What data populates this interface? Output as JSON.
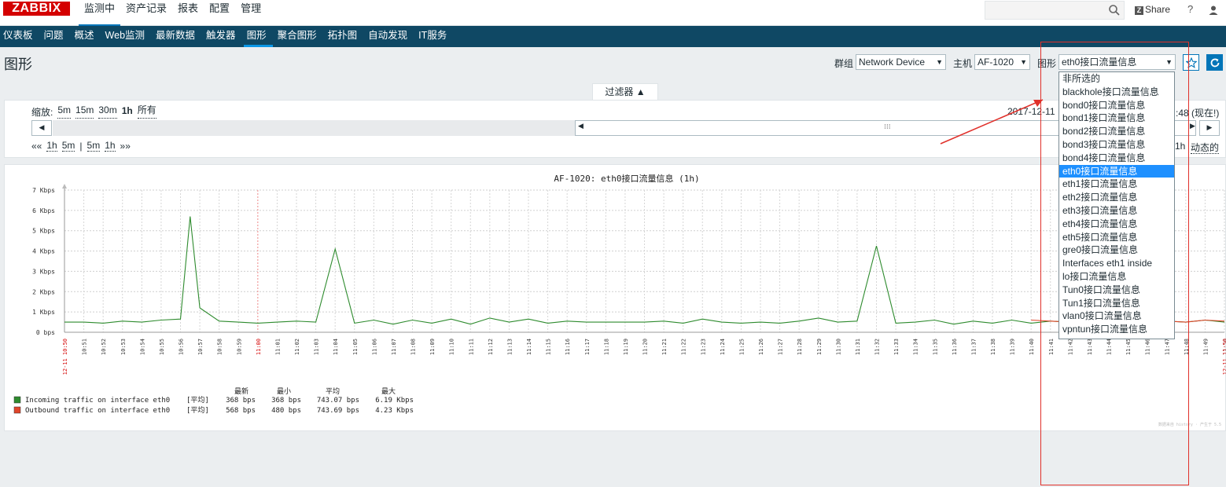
{
  "app": {
    "logo": "ZABBIX",
    "main_menu": [
      "监测中",
      "资产记录",
      "报表",
      "配置",
      "管理"
    ],
    "share": "Share",
    "help": "?",
    "share_badge": "Z"
  },
  "submenu": [
    "仪表板",
    "问题",
    "概述",
    "Web监测",
    "最新数据",
    "触发器",
    "图形",
    "聚合图形",
    "拓扑图",
    "自动发现",
    "IT服务"
  ],
  "header": {
    "title": "图形",
    "group_label": "群组",
    "group_value": "Network Device",
    "host_label": "主机",
    "host_value": "AF-1020",
    "graph_label": "图形",
    "graph_value": "eth0接口流量信息"
  },
  "filter": {
    "tab_label": "过滤器 ▲",
    "zoom_label": "缩放:",
    "zoom_options": [
      "5m",
      "15m",
      "30m",
      "1h",
      "所有"
    ],
    "zoom_current": "1h",
    "date_start": "2017-12-11",
    "date_end": ":48 (现在!)",
    "nav_left": "««",
    "nav_items": [
      "1h",
      "5m",
      "|",
      "5m",
      "1h",
      "»»"
    ],
    "right_1h": "1h",
    "right_dynamic": "动态的"
  },
  "dropdown": {
    "options": [
      "非所选的",
      "blackhole接口流量信息",
      "bond0接口流量信息",
      "bond1接口流量信息",
      "bond2接口流量信息",
      "bond3接口流量信息",
      "bond4接口流量信息",
      "eth0接口流量信息",
      "eth1接口流量信息",
      "eth2接口流量信息",
      "eth3接口流量信息",
      "eth4接口流量信息",
      "eth5接口流量信息",
      "gre0接口流量信息",
      "Interfaces eth1 inside",
      "lo接口流量信息",
      "Tun0接口流量信息",
      "Tun1接口流量信息",
      "vlan0接口流量信息",
      "vpntun接口流量信息"
    ],
    "selected_index": 7
  },
  "chart_data": {
    "type": "line",
    "title": "AF-1020: eth0接口流量信息 (1h)",
    "y_ticks": [
      "0 bps",
      "1 Kbps",
      "2 Kbps",
      "3 Kbps",
      "4 Kbps",
      "5 Kbps",
      "6 Kbps",
      "7 Kbps"
    ],
    "ylim": [
      0,
      7
    ],
    "x_ticks": [
      "10:51",
      "10:52",
      "10:53",
      "10:54",
      "10:55",
      "10:56",
      "10:57",
      "10:58",
      "10:59",
      "11:00",
      "11:01",
      "11:02",
      "11:03",
      "11:04",
      "11:05",
      "11:06",
      "11:07",
      "11:08",
      "11:09",
      "11:10",
      "11:11",
      "11:12",
      "11:13",
      "11:14",
      "11:15",
      "11:16",
      "11:17",
      "11:18",
      "11:19",
      "11:20",
      "11:21",
      "11:22",
      "11:23",
      "11:24",
      "11:25",
      "11:26",
      "11:27",
      "11:28",
      "11:29",
      "11:30",
      "11:31",
      "11:32",
      "11:33",
      "11:34",
      "11:35",
      "11:36",
      "11:37",
      "11:38",
      "11:39",
      "11:40",
      "11:41",
      "11:42",
      "11:43",
      "11:44",
      "11:45",
      "11:46",
      "11:47",
      "11:48",
      "11:49",
      "11:50"
    ],
    "x_start_label": "12-11 10:50",
    "x_end_label": "12-11 11:50",
    "x_mid_label": "11:00",
    "xlim": [
      0,
      60
    ],
    "series": [
      {
        "name": "Incoming traffic on interface eth0",
        "color": "#2e8b2e",
        "x": [
          0,
          1,
          2,
          3,
          4,
          5,
          6,
          6.5,
          7,
          8,
          9,
          10,
          11,
          12,
          13,
          14,
          15,
          16,
          17,
          18,
          19,
          20,
          21,
          22,
          23,
          24,
          25,
          26,
          27,
          28,
          29,
          30,
          31,
          32,
          33,
          34,
          35,
          36,
          37,
          38,
          39,
          40,
          41,
          42,
          43,
          44,
          45,
          46,
          47,
          48,
          49,
          50,
          51,
          52,
          53,
          54,
          55,
          56,
          56.5,
          57,
          58,
          59,
          60
        ],
        "y": [
          0.5,
          0.5,
          0.45,
          0.55,
          0.5,
          0.6,
          0.65,
          5.7,
          1.2,
          0.55,
          0.5,
          0.45,
          0.5,
          0.55,
          0.5,
          4.1,
          0.45,
          0.6,
          0.4,
          0.6,
          0.45,
          0.65,
          0.4,
          0.7,
          0.5,
          0.65,
          0.45,
          0.55,
          0.5,
          0.5,
          0.5,
          0.5,
          0.55,
          0.45,
          0.65,
          0.5,
          0.45,
          0.5,
          0.45,
          0.55,
          0.7,
          0.5,
          0.55,
          4.25,
          0.45,
          0.5,
          0.6,
          0.4,
          0.55,
          0.45,
          0.6,
          0.45,
          0.55,
          0.5,
          0.6,
          0.45,
          0.5,
          0.75,
          0.45,
          0.55,
          0.5,
          0.6,
          0.5
        ],
        "legend_last": "368 bps",
        "legend_min": "368 bps",
        "legend_avg": "743.07 bps",
        "legend_max": "6.19 Kbps"
      },
      {
        "name": "Outbound traffic on interface eth0",
        "color": "#e0452a",
        "x": [
          50,
          51,
          52,
          53,
          54,
          55,
          56,
          57,
          58,
          59,
          60
        ],
        "y": [
          0.6,
          0.55,
          0.5,
          0.6,
          0.55,
          0.6,
          0.5,
          0.55,
          0.5,
          0.6,
          0.55
        ],
        "legend_last": "568 bps",
        "legend_min": "480 bps",
        "legend_avg": "743.69 bps",
        "legend_max": "4.23 Kbps"
      }
    ],
    "legend_headers": [
      "最新",
      "最小",
      "平均",
      "最大"
    ],
    "legend_func": "[平均]",
    "footer_note": "数据来自 history · 产生于 5.5"
  }
}
